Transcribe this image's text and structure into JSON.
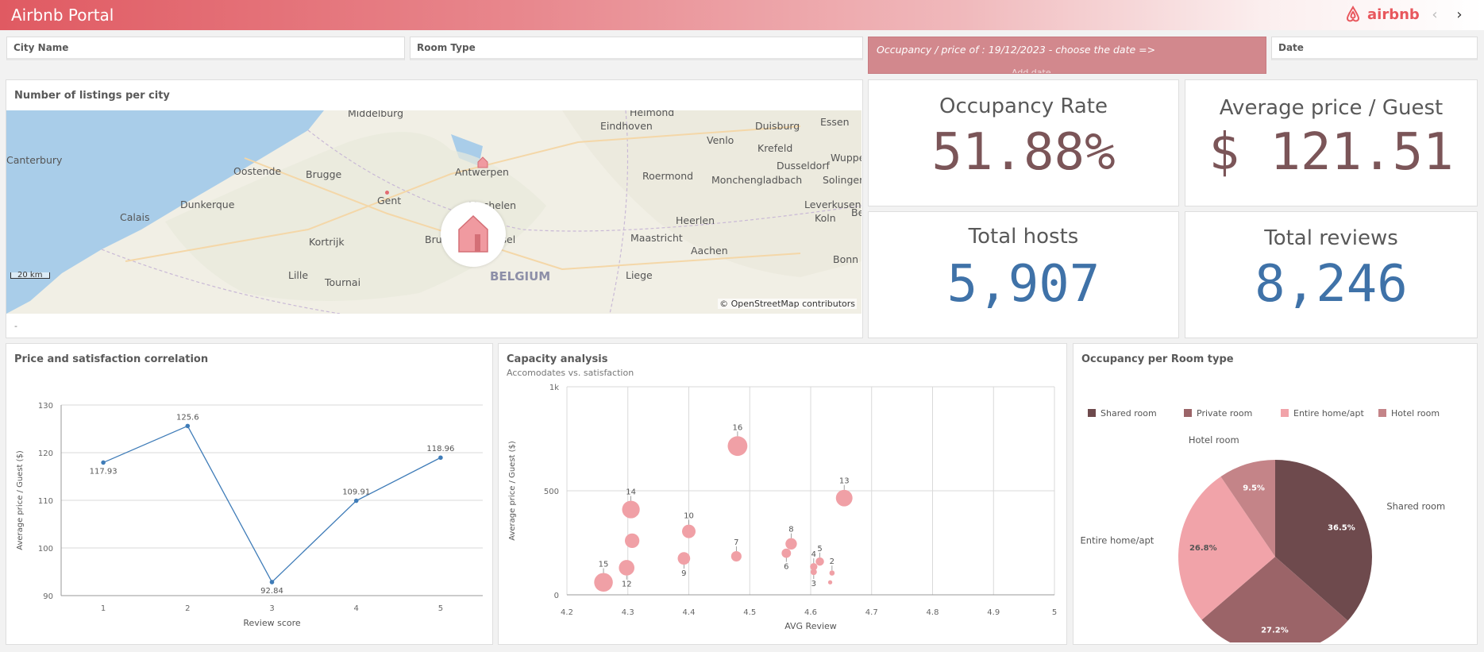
{
  "app": {
    "title": "Airbnb Portal",
    "brand": "airbnb"
  },
  "filters": {
    "city": "City Name",
    "room_type": "Room Type",
    "date": "Date"
  },
  "date_banner": {
    "text": "Occupancy / price of : 19/12/2023 - choose the date =>",
    "hint": "Add date"
  },
  "map_panel": {
    "title": "Number of listings per city",
    "footer": "-",
    "scale": "20 km",
    "attribution": "© OpenStreetMap contributors",
    "cities": [
      "Middelburg",
      "Helmond",
      "Eindhoven",
      "Duisburg",
      "Essen",
      "Canterbury",
      "Oostende",
      "Brugge",
      "Antwerpen",
      "Venlo",
      "Krefeld",
      "Wuppe",
      "Dusseldorf",
      "Roermond",
      "Monchengladbach",
      "Solinger",
      "Dunkerque",
      "Gent",
      "Mechelen",
      "Leverkusen",
      "Calais",
      "Heerlen",
      "Koln",
      "Be",
      "Kortrijk",
      "Bru",
      "ssel",
      "Maastricht",
      "Aachen",
      "Lille",
      "Tournai",
      "Liege",
      "Bonn"
    ],
    "country": "BELGIUM"
  },
  "kpis": {
    "occupancy": {
      "label": "Occupancy Rate",
      "value": "51.88%"
    },
    "avg_price": {
      "label": "Average price / Guest",
      "value": "$ 121.51"
    },
    "hosts": {
      "label": "Total hosts",
      "value": "5,907"
    },
    "reviews": {
      "label": "Total reviews",
      "value": "8,246"
    }
  },
  "colors": {
    "kpi_brown": "#7b5558",
    "kpi_blue": "#3f72a8",
    "accent": "#e8575d",
    "shared": "#6e4a4d",
    "private": "#9b6468",
    "entire": "#f1a3a9",
    "hotel": "#c48488",
    "bubble": "#f0a0a6",
    "line": "#3f7cb8"
  },
  "chart_data": [
    {
      "type": "line",
      "title": "Price and satisfaction correlation",
      "xlabel": "Review score",
      "ylabel": "Average price / Guest ($)",
      "x": [
        1,
        2,
        3,
        4,
        5
      ],
      "values": [
        117.93,
        125.6,
        92.84,
        109.91,
        118.96
      ],
      "labels": [
        "117.93",
        "125.6",
        "92.84",
        "109.91",
        "118.96"
      ],
      "ylim": [
        90,
        130
      ],
      "yticks": [
        90,
        100,
        110,
        120,
        130
      ],
      "xticks": [
        1,
        2,
        3,
        4,
        5
      ],
      "grid": true
    },
    {
      "type": "scatter",
      "title": "Capacity analysis",
      "subtitle": "Accomodates vs. satisfaction",
      "xlabel": "AVG Review",
      "ylabel": "Average price / Guest ($)",
      "xlim": [
        4.2,
        5
      ],
      "ylim": [
        0,
        1000
      ],
      "xticks": [
        "4.2",
        "4.3",
        "4.4",
        "4.5",
        "4.6",
        "4.7",
        "4.8",
        "4.9",
        "5"
      ],
      "yticks": [
        "0",
        "500",
        "1k"
      ],
      "grid": true,
      "points": [
        {
          "label": "16",
          "x": 4.48,
          "y": 715,
          "size": 16
        },
        {
          "label": "14",
          "x": 4.305,
          "y": 410,
          "size": 14
        },
        {
          "label": "13",
          "x": 4.655,
          "y": 465,
          "size": 13
        },
        {
          "label": "10",
          "x": 4.4,
          "y": 305,
          "size": 10
        },
        {
          "label": "",
          "x": 4.307,
          "y": 260,
          "size": 11
        },
        {
          "label": "8",
          "x": 4.568,
          "y": 245,
          "size": 8
        },
        {
          "label": "7",
          "x": 4.478,
          "y": 185,
          "size": 7
        },
        {
          "label": "9",
          "x": 4.392,
          "y": 175,
          "size": 9
        },
        {
          "label": "6",
          "x": 4.56,
          "y": 200,
          "size": 6
        },
        {
          "label": "5",
          "x": 4.615,
          "y": 160,
          "size": 5
        },
        {
          "label": "4",
          "x": 4.605,
          "y": 135,
          "size": 4
        },
        {
          "label": "3",
          "x": 4.605,
          "y": 110,
          "size": 3
        },
        {
          "label": "2",
          "x": 4.635,
          "y": 105,
          "size": 2
        },
        {
          "label": "12",
          "x": 4.298,
          "y": 130,
          "size": 12
        },
        {
          "label": "15",
          "x": 4.26,
          "y": 60,
          "size": 15
        },
        {
          "label": "",
          "x": 4.632,
          "y": 60,
          "size": 1
        }
      ]
    },
    {
      "type": "pie",
      "title": "Occupancy per Room type",
      "legend_position": "top",
      "slices": [
        {
          "name": "Shared room",
          "value": 36.5,
          "label": "36.5%"
        },
        {
          "name": "Private room",
          "value": 27.2,
          "label": "27.2%"
        },
        {
          "name": "Entire home/apt",
          "value": 26.8,
          "label": "26.8%"
        },
        {
          "name": "Hotel room",
          "value": 9.5,
          "label": "9.5%"
        }
      ]
    }
  ]
}
